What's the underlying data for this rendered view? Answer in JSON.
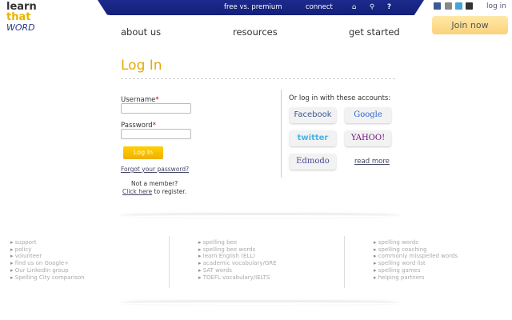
{
  "logo": {
    "line1": "learn",
    "line2": "that",
    "line3": "WORD"
  },
  "topbar": {
    "premium": "free vs. premium",
    "connect": "connect",
    "home_icon": "home-icon",
    "search_icon": "search-icon",
    "help": "?"
  },
  "social": [
    "facebook-icon",
    "delicious-icon",
    "twitter-icon",
    "rss-icon"
  ],
  "login_link": "log in",
  "join": "Join now",
  "nav": [
    "about us",
    "resources",
    "get started"
  ],
  "page_title": "Log In",
  "form": {
    "username_label": "Username",
    "password_label": "Password",
    "required": "*",
    "submit": "Log In",
    "forgot": "Forgot your password?",
    "not_member": "Not a member?",
    "click_here": "Click here",
    "register": " to register."
  },
  "social_login": {
    "heading": "Or log in with these accounts:",
    "providers": [
      "Facebook",
      "Google",
      "twitter",
      "YAHOO!",
      "Edmodo"
    ],
    "read_more": "read more"
  },
  "footer": {
    "col1": [
      "support",
      "policy",
      "volunteer",
      "find us on Google+",
      "Our LinkedIn group",
      "Spelling City comparison"
    ],
    "col2": [
      "spelling bee",
      "spelling bee words",
      "learn English (ELL)",
      "academic vocabulary/GRE",
      "SAT words",
      "TOEFL vocabulary/IELTS"
    ],
    "col3": [
      "spelling words",
      "spelling coaching",
      "commonly misspelled words",
      "spelling word list",
      "spelling games",
      "helping partners"
    ]
  }
}
